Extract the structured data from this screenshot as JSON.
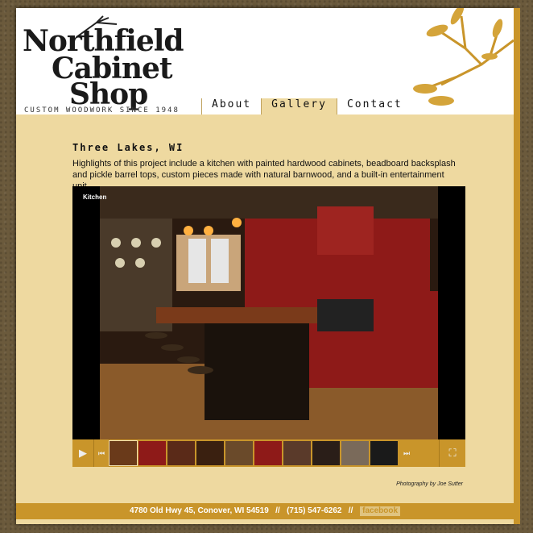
{
  "logo": {
    "line1": "Northfield",
    "line2": "Cabinet",
    "line3": "Shop",
    "tagline": "CUSTOM WOODWORK SINCE 1948"
  },
  "nav": [
    {
      "label": "About"
    },
    {
      "label": "Gallery"
    },
    {
      "label": "Contact"
    }
  ],
  "main": {
    "title": "Three Lakes, WI",
    "description": "Highlights of this project include a kitchen with painted hardwood cabinets, beadboard backsplash and pickle barrel tops, custom pieces made with natural barnwood, and a built-in entertainment unit."
  },
  "viewer": {
    "caption": "Kitchen",
    "controls": {
      "play_icon": "play-icon",
      "prev_icon": "skip-back-icon",
      "next_icon": "skip-forward-icon",
      "fullscreen_icon": "fullscreen-icon"
    }
  },
  "credit": "Photography by Joe Sutter",
  "footer": {
    "address": "4780 Old Hwy 45, Conover, WI 54519",
    "sep": "//",
    "phone": "(715) 547-6262",
    "facebook": "facebook"
  },
  "colors": {
    "accent": "#c9952a",
    "background": "#eed9a0",
    "cabinet_red": "#8e1a18"
  }
}
